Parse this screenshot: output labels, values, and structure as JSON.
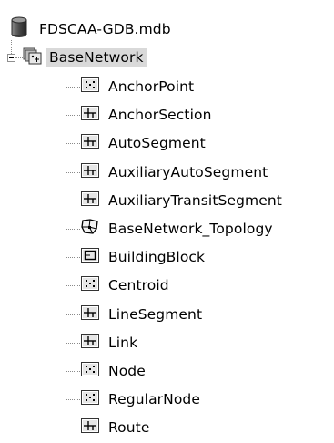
{
  "tree": {
    "root": {
      "label": "FDSCAA-GDB.mdb",
      "icon": "database-icon"
    },
    "dataset": {
      "label": "BaseNetwork",
      "icon": "feature-dataset-icon",
      "expanded": true,
      "selected": true
    },
    "children": [
      {
        "label": "AnchorPoint",
        "icon": "point-feature-class-icon"
      },
      {
        "label": "AnchorSection",
        "icon": "line-feature-class-icon"
      },
      {
        "label": "AutoSegment",
        "icon": "line-feature-class-icon"
      },
      {
        "label": "AuxiliaryAutoSegment",
        "icon": "line-feature-class-icon"
      },
      {
        "label": "AuxiliaryTransitSegment",
        "icon": "line-feature-class-icon"
      },
      {
        "label": "BaseNetwork_Topology",
        "icon": "topology-icon"
      },
      {
        "label": "BuildingBlock",
        "icon": "polygon-feature-class-icon"
      },
      {
        "label": "Centroid",
        "icon": "point-feature-class-icon"
      },
      {
        "label": "LineSegment",
        "icon": "line-feature-class-icon"
      },
      {
        "label": "Link",
        "icon": "line-feature-class-icon"
      },
      {
        "label": "Node",
        "icon": "point-feature-class-icon"
      },
      {
        "label": "RegularNode",
        "icon": "point-feature-class-icon"
      },
      {
        "label": "Route",
        "icon": "line-feature-class-icon"
      }
    ]
  }
}
